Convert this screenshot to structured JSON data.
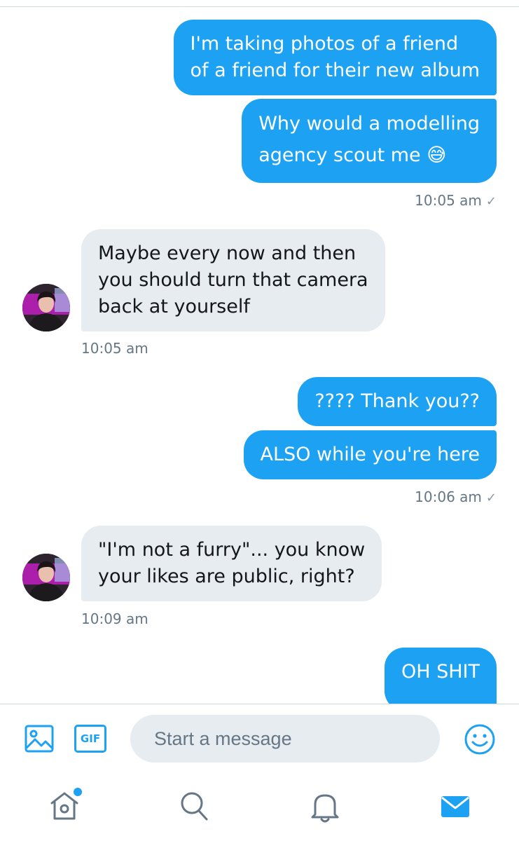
{
  "thread": {
    "messages": [
      {
        "direction": "outgoing",
        "lines": [
          "I'm taking photos of a friend",
          "of a friend for their new album"
        ]
      },
      {
        "direction": "outgoing",
        "lines": [
          "Why would a modelling",
          "agency scout me 😅"
        ]
      },
      {
        "direction": "outgoing",
        "lines": [
          "???? Thank you??"
        ]
      },
      {
        "direction": "outgoing",
        "lines": [
          "ALSO while you're here"
        ]
      },
      {
        "direction": "incoming",
        "lines": [
          "Maybe every now and then",
          "you should turn that camera",
          "back at yourself"
        ]
      },
      {
        "direction": "incoming",
        "lines": [
          "\"I'm not a furry\"... you know",
          "your likes are public, right?"
        ]
      },
      {
        "direction": "outgoing",
        "lines": [
          "OH SHIT"
        ]
      }
    ],
    "timestamps": {
      "t1": "10:05 am",
      "t2": "10:05 am",
      "t3": "10:06 am",
      "t4": "10:09 am"
    },
    "read_check": "✓"
  },
  "composer": {
    "placeholder": "Start a message",
    "gif_label": "GIF",
    "icons": [
      "image-icon",
      "gif-icon",
      "emoji-icon"
    ]
  },
  "tab_bar": {
    "items": [
      "home-icon",
      "search-icon",
      "notifications-icon",
      "messages-icon"
    ],
    "active": "messages-icon",
    "home_has_new": true
  },
  "colors": {
    "accent": "#1da1f2",
    "incoming_bubble": "#e6ecf0",
    "muted_text": "#657786",
    "tab_inactive": "#657786"
  }
}
